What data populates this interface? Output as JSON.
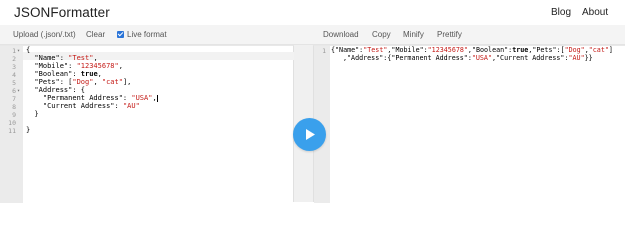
{
  "header": {
    "brand": "JSONFormatter",
    "nav": [
      {
        "label": "Blog"
      },
      {
        "label": "About"
      }
    ]
  },
  "toolbar_left": {
    "upload_label": "Upload (.json/.txt)",
    "clear_label": "Clear",
    "live_format_label": "Live format",
    "live_format_checked": true
  },
  "toolbar_right": {
    "download_label": "Download",
    "copy_label": "Copy",
    "minify_label": "Minify",
    "prettify_label": "Prettify"
  },
  "left_editor": {
    "line_numbers": [
      "1",
      "2",
      "3",
      "4",
      "5",
      "6",
      "7",
      "8",
      "9",
      "10",
      "11"
    ],
    "lines": [
      "{",
      "  \"Name\": \"Test\",",
      "  \"Mobile\": \"12345678\",",
      "  \"Boolean\": true,",
      "  \"Pets\": [\"Dog\", \"cat\"],",
      "  \"Address\": {",
      "    \"Permanent Address\": \"USA\",",
      "    \"Current Address\": \"AU\"",
      "  }",
      "",
      "}"
    ]
  },
  "right_editor": {
    "line_numbers": [
      "1"
    ],
    "line1": "{\"Name\":\"Test\",\"Mobile\":\"12345678\",\"Boolean\":true,\"Pets\":[\"Dog\",\"cat\"]",
    "line1_wrap": ",\"Address\":{\"Permanent Address\":\"USA\",\"Current Address\":\"AU\"}}"
  },
  "run_button": {
    "icon": "play-icon",
    "color": "#3aa0ec"
  }
}
